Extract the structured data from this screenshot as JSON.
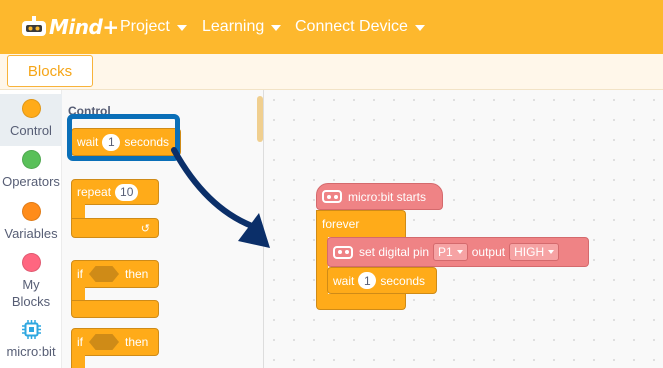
{
  "header": {
    "logo_text": "Mind+",
    "menu": [
      "Project",
      "Learning",
      "Connect Device"
    ]
  },
  "tabs": {
    "blocks": "Blocks"
  },
  "categories": [
    {
      "label": "Control",
      "color": "#ffab19"
    },
    {
      "label": "Operators",
      "color": "#59c059"
    },
    {
      "label": "Variables",
      "color": "#ff8c1a"
    },
    {
      "label": "My Blocks",
      "color": "#ff6680"
    },
    {
      "label": "micro:bit",
      "color": "#2ea7e0"
    }
  ],
  "flyout": {
    "heading": "Control",
    "wait": {
      "text": "wait",
      "value": "1",
      "unit": "seconds"
    },
    "repeat": {
      "text": "repeat",
      "value": "10"
    },
    "if1": {
      "if": "if",
      "then": "then"
    },
    "if2": {
      "if": "if",
      "then": "then"
    }
  },
  "workspace": {
    "start": "micro:bit starts",
    "forever": "forever",
    "set_pin": {
      "text": "set digital pin",
      "pin": "P1",
      "output": "output",
      "level": "HIGH"
    },
    "wait": {
      "text": "wait",
      "value": "1",
      "unit": "seconds"
    }
  },
  "colors": {
    "header": "#fdb82d",
    "control": "#ffab19",
    "microbit": "#ef8385",
    "highlight": "#0a6fb8",
    "arrow": "#0b2f69"
  }
}
